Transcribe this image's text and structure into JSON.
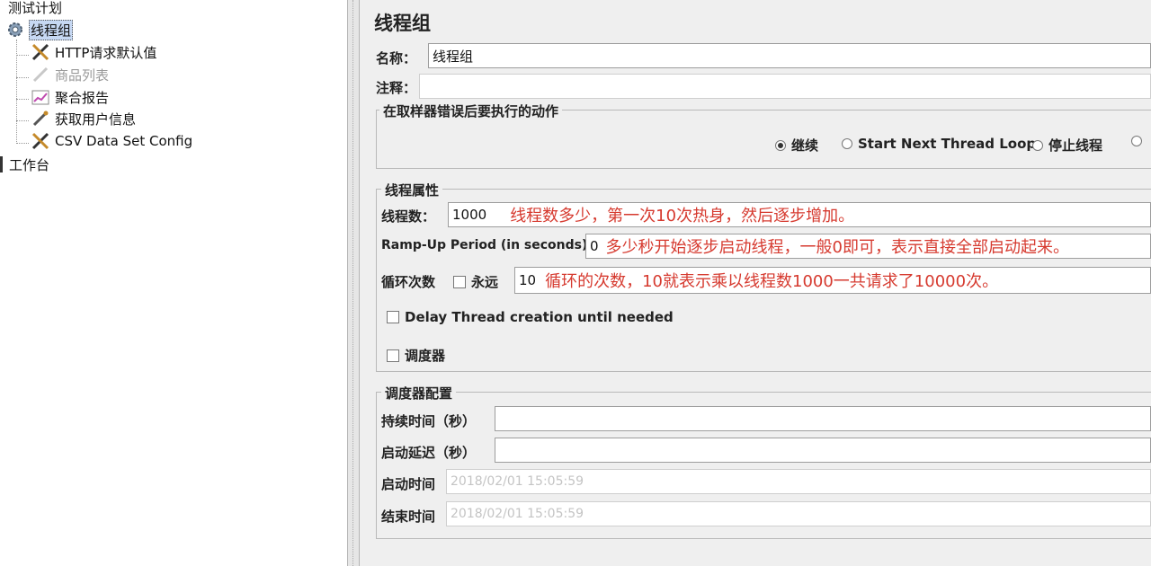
{
  "tree": {
    "root": "测试计划",
    "items": [
      {
        "label": "线程组",
        "icon": "gear-icon",
        "selected": true
      },
      {
        "label": "HTTP请求默认值",
        "icon": "wrench-icon"
      },
      {
        "label": "商品列表",
        "icon": "sampler-pen-icon",
        "disabled": true
      },
      {
        "label": "聚合报告",
        "icon": "chart-icon"
      },
      {
        "label": "获取用户信息",
        "icon": "sampler-pen-icon"
      },
      {
        "label": "CSV Data Set Config",
        "icon": "wrench-icon"
      }
    ],
    "workbench": "工作台"
  },
  "panel": {
    "title": "线程组",
    "name_label": "名称：",
    "name_value": "线程组",
    "comment_label": "注释：",
    "comment_value": "",
    "error_action": {
      "title": "在取样器错误后要执行的动作",
      "options": [
        "继续",
        "Start Next Thread Loop",
        "停止线程"
      ],
      "selected": "继续"
    },
    "thread_props": {
      "title": "线程属性",
      "threads_label": "线程数：",
      "threads_value": "1000",
      "threads_note": "线程数多少，第一次10次热身，然后逐步增加。",
      "rampup_label": "Ramp-Up Period (in seconds):",
      "rampup_value": "0",
      "rampup_note": "多少秒开始逐步启动线程，一般0即可，表示直接全部启动起来。",
      "loop_label": "循环次数",
      "forever_label": "永远",
      "loop_value": "10",
      "loop_note": "循环的次数，10就表示乘以线程数1000一共请求了10000次。",
      "delay_label": "Delay Thread creation until needed",
      "scheduler_label": "调度器"
    },
    "scheduler": {
      "title": "调度器配置",
      "duration_label": "持续时间（秒）",
      "duration_value": "",
      "delay_label": "启动延迟（秒）",
      "delay_value": "",
      "start_label": "启动时间",
      "start_value": "2018/02/01 15:05:59",
      "end_label": "结束时间",
      "end_value": "2018/02/01 15:05:59"
    }
  },
  "colors": {
    "annotation": "#d63a2f",
    "selection": "#c6d8f3",
    "panel_bg": "#efefef"
  }
}
